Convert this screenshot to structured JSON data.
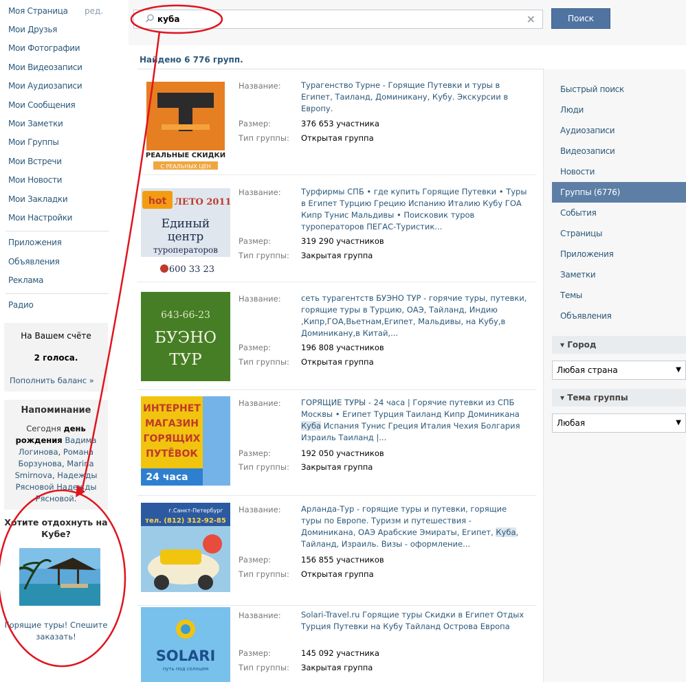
{
  "sidebar": {
    "edit_label": "ред.",
    "nav": [
      "Моя Страница",
      "Мои Друзья",
      "Мои Фотографии",
      "Мои Видеозаписи",
      "Мои Аудиозаписи",
      "Мои Сообщения",
      "Мои Заметки",
      "Мои Группы",
      "Мои Встречи",
      "Мои Новости",
      "Мои Закладки",
      "Мои Настройки"
    ],
    "nav2": [
      "Приложения",
      "Объявления",
      "Реклама"
    ],
    "nav3": [
      "Радио"
    ],
    "balance": {
      "label": "На Вашем счёте",
      "value": "2 голоса.",
      "link": "Пополнить баланс »"
    },
    "reminder": {
      "title": "Напоминание",
      "text_prefix": "Сегодня ",
      "text_bold": "день рождения",
      "names": [
        "Вадима Логинова",
        "Романа Борзунова",
        "Marina Smirnova",
        "Надежды Рясновой",
        "Надежды Рясновой"
      ]
    },
    "ad": {
      "title": "Хотите отдохнуть на Кубе?",
      "text": "Горящие туры! Спешите заказать!"
    }
  },
  "search": {
    "query": "куба",
    "clear_icon": "×",
    "button_label": "Поиск"
  },
  "results_summary": "Найдено 6 776 групп.",
  "labels": {
    "name": "Название:",
    "size": "Размер:",
    "type": "Тип группы:"
  },
  "results": [
    {
      "name": "Турагенство Турне - Горящие Путевки и туры в Египет, Таиланд, Доминикану, Кубу. Экскурсии в Европу.",
      "size": "376 653 участника",
      "type": "Открытая группа",
      "thumb": [
        "РЕАЛЬНЫЕ СКИДКИ",
        "С РЕАЛЬНЫХ ЦЕН"
      ]
    },
    {
      "name": "Турфирмы СПБ • где купить Горящие Путевки • Туры в Египет Турцию Грецию Испанию Италию Кубу ГОА Кипр Тунис Мальдивы • Поисковик туров туроператоров ПЕГАС-Туристик...",
      "size": "319 290 участников",
      "type": "Закрытая группа",
      "thumb": [
        "hot",
        "ЛЕТО 2011",
        "Единый",
        "центр",
        "туроператоров",
        "600 33 23"
      ]
    },
    {
      "name": "сеть турагентств БУЭНО ТУР - горячие туры, путевки, горящие туры в Турцию, ОАЭ, Тайланд, Индию ,Кипр,ГОА,Вьетнам,Египет, Мальдивы, на Кубу,в Доминикану,в Китай,...",
      "size": "196 808 участников",
      "type": "Открытая группа",
      "thumb": [
        "643-66-23",
        "БУЭНО",
        "ТУР"
      ]
    },
    {
      "name_parts": [
        "ГОРЯЩИЕ ТУРЫ - 24 часа | Горячие путевки из СПБ Москвы • Египет Турция Таиланд Кипр Доминикана ",
        "Куба",
        " Испания Тунис Греция Италия Чехия Болгария Израиль Таиланд |..."
      ],
      "size": "192 050 участников",
      "type": "Закрытая группа",
      "thumb": [
        "ИНТЕРНЕТ",
        "МАГАЗИН",
        "ГОРЯЩИХ",
        "ПУТЁВОК",
        "24 часа"
      ]
    },
    {
      "name_parts": [
        "Арланда-Тур - горящие туры и путевки, горящие туры по Европе. Туризм и путешествия - Доминикана, ОАЭ Арабские Эмираты, Египет, ",
        "Куба",
        ", Тайланд, Израиль. Визы - оформление..."
      ],
      "size": "156 855 участников",
      "type": "Открытая группа",
      "thumb": [
        "г.Санкт-Петербург",
        "тел. (812) 312-92-85"
      ]
    },
    {
      "name": "Solari-Travel.ru Горящие туры Скидки в Египет Отдых Турция Путевки на Кубу Тайланд Острова Европа",
      "size": "145 092 участника",
      "type": "Закрытая группа",
      "thumb": [
        "SOLARI",
        "путь под солнцем"
      ]
    }
  ],
  "filters": {
    "items": [
      "Быстрый поиск",
      "Люди",
      "Аудиозаписи",
      "Видеозаписи",
      "Новости",
      "Группы (6776)",
      "События",
      "Страницы",
      "Приложения",
      "Заметки",
      "Темы",
      "Объявления"
    ],
    "active_index": 5,
    "city_header": "▾ Город",
    "city_value": "Любая страна",
    "topic_header": "▾ Тема группы",
    "topic_value": "Любая"
  },
  "colors": {
    "link": "#2B587A",
    "button": "#4f74a1",
    "active": "#5d7fa6",
    "annotation": "#e0141e"
  }
}
